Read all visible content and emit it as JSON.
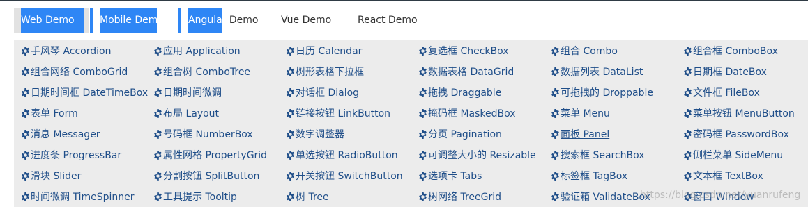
{
  "tabs": [
    {
      "id": "tab-web",
      "label": "Web Demo"
    },
    {
      "id": "tab-mobile",
      "label": "Mobile Demo"
    },
    {
      "id": "tab-angular",
      "label_a": "Angular",
      "label_b": " Demo"
    },
    {
      "id": "tab-vue",
      "label": "Vue Demo"
    },
    {
      "id": "tab-react",
      "label": "React Demo"
    }
  ],
  "components": [
    "手风琴 Accordion",
    "应用 Application",
    "日历 Calendar",
    "复选框 CheckBox",
    "组合 Combo",
    "组合框 ComboBox",
    "组合网络 ComboGrid",
    "组合树 ComboTree",
    "树形表格下拉框",
    "数据表格 DataGrid",
    "数据列表 DataList",
    "日期框 DateBox",
    "日期时间框 DateTimeBox",
    "日期时间微调",
    "对话框 Dialog",
    "拖拽 Draggable",
    "可拖拽的 Droppable",
    "文件框 FileBox",
    "表单 Form",
    "布局 Layout",
    "链接按钮 LinkButton",
    "掩码框 MaskedBox",
    "菜单 Menu",
    "菜单按钮 MenuButton",
    "消息 Messager",
    "号码框 NumberBox",
    "数字调整器",
    "分页 Pagination",
    "面板 Panel",
    "密码框 PasswordBox",
    "进度条 ProgressBar",
    "属性网格 PropertyGrid",
    "单选按钮 RadioButton",
    "可调整大小的 Resizable",
    "搜索框 SearchBox",
    "侧栏菜单 SideMenu",
    "滑块 Slider",
    "分割按钮 SplitButton",
    "开关按钮 SwitchButton",
    "选项卡 Tabs",
    "标签框 TagBox",
    "文本框 TextBox",
    "时间微调 TimeSpinner",
    "工具提示 Tooltip",
    "树 Tree",
    "树网络 TreeGrid",
    "验证箱 ValidateBox",
    "窗口 Window"
  ],
  "underlined_item": "面板 Panel",
  "icon": "gear-icon",
  "colors": {
    "accent": "#2e86f5",
    "link": "#1f4e89",
    "panel": "#ececec"
  },
  "watermark": "https://blog.csdn.net/yuanrufeng"
}
